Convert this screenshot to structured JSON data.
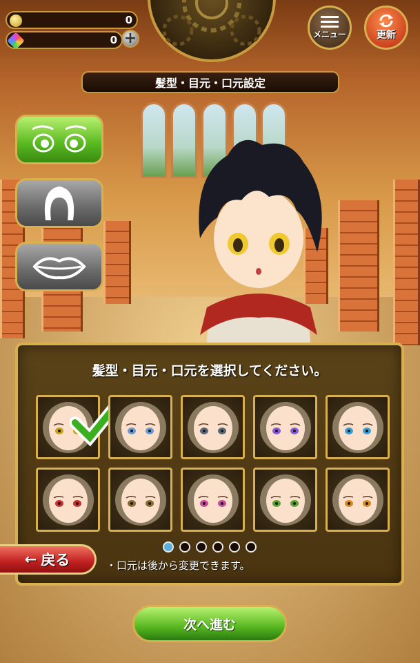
{
  "header": {
    "currency1_value": "0",
    "currency2_value": "0",
    "plus_label": "+",
    "menu_label": "メニュー",
    "update_label": "更新",
    "title": "髪型・目元・口元設定"
  },
  "categories": [
    {
      "name": "eyes",
      "icon": "eyes-icon",
      "active": true
    },
    {
      "name": "hair",
      "icon": "hair-icon",
      "active": false
    },
    {
      "name": "mouth",
      "icon": "lips-icon",
      "active": false
    }
  ],
  "panel": {
    "title": "髪型・目元・口元を選択してください。",
    "note": "・口元は後から変更できます。",
    "faces": [
      {
        "eye_color": "#c8a020",
        "selected": true
      },
      {
        "eye_color": "#6a9ad8",
        "selected": false
      },
      {
        "eye_color": "#5a6a7a",
        "selected": false
      },
      {
        "eye_color": "#8a5ad8",
        "selected": false
      },
      {
        "eye_color": "#3aa0d8",
        "selected": false
      },
      {
        "eye_color": "#c83030",
        "selected": false
      },
      {
        "eye_color": "#8a6a30",
        "selected": false
      },
      {
        "eye_color": "#c84a9a",
        "selected": false
      },
      {
        "eye_color": "#5aa030",
        "selected": false
      },
      {
        "eye_color": "#d88a20",
        "selected": false
      }
    ],
    "page_count": 6,
    "current_page": 1
  },
  "buttons": {
    "back_label": "戻る",
    "back_arrow": "←",
    "next_label": "次へ進む"
  },
  "colors": {
    "accent_gold": "#d8b050",
    "green": "#58b820",
    "red": "#c02020"
  }
}
